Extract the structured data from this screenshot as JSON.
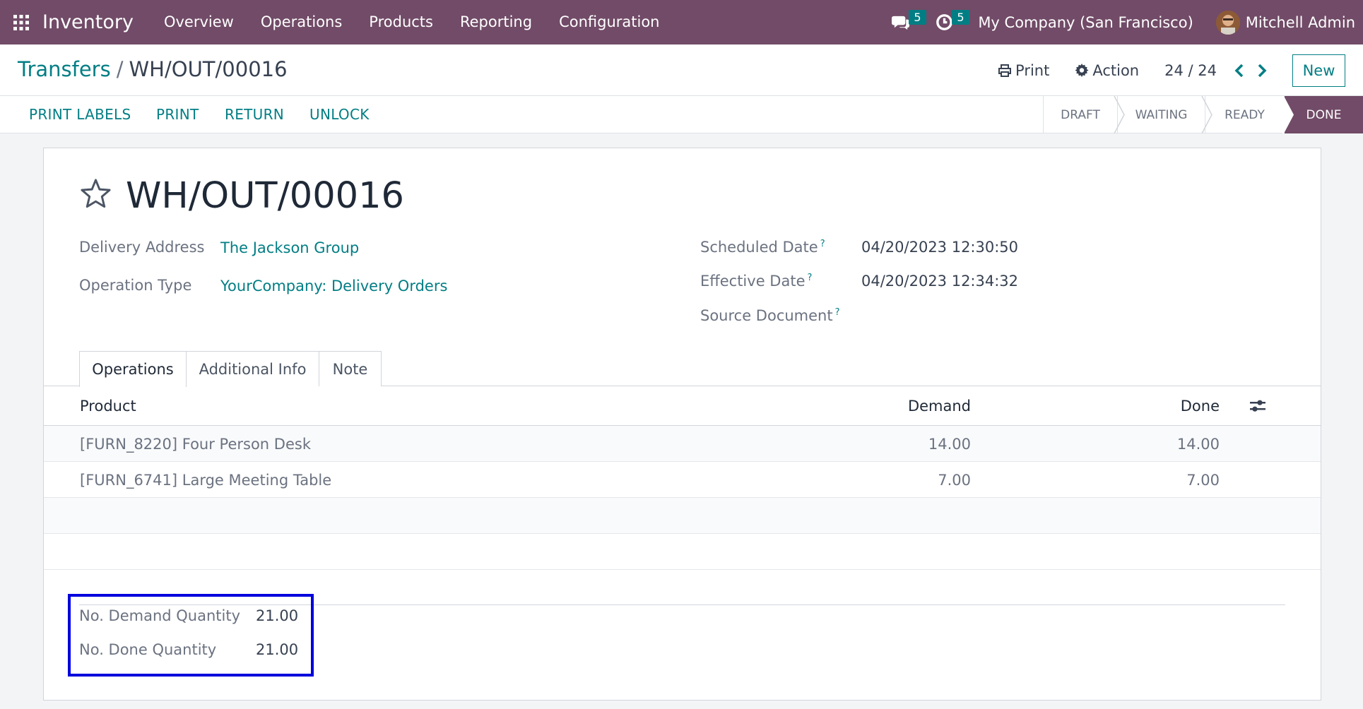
{
  "navbar": {
    "app_name": "Inventory",
    "menu": [
      "Overview",
      "Operations",
      "Products",
      "Reporting",
      "Configuration"
    ],
    "messages_count": "5",
    "activities_count": "5",
    "company": "My Company (San Francisco)",
    "user": "Mitchell Admin",
    "color": "#714b67"
  },
  "control": {
    "breadcrumb_parent": "Transfers",
    "breadcrumb_separator": "/",
    "breadcrumb_current": "WH/OUT/00016",
    "print_label": "Print",
    "action_label": "Action",
    "pager": "24 / 24",
    "new_label": "New"
  },
  "statusbar": {
    "actions": [
      "PRINT LABELS",
      "PRINT",
      "RETURN",
      "UNLOCK"
    ],
    "stages": [
      "DRAFT",
      "WAITING",
      "READY",
      "DONE"
    ],
    "current_stage": "DONE"
  },
  "form": {
    "title": "WH/OUT/00016",
    "delivery_address_label": "Delivery Address",
    "delivery_address": "The Jackson Group",
    "operation_type_label": "Operation Type",
    "operation_type": "YourCompany: Delivery Orders",
    "scheduled_date_label": "Scheduled Date",
    "scheduled_date": "04/20/2023 12:30:50",
    "effective_date_label": "Effective Date",
    "effective_date": "04/20/2023 12:34:32",
    "source_document_label": "Source Document",
    "help_mark": "?"
  },
  "tabs": [
    "Operations",
    "Additional Info",
    "Note"
  ],
  "table": {
    "columns": [
      "Product",
      "Demand",
      "Done"
    ],
    "rows": [
      {
        "product": "[FURN_8220] Four Person Desk",
        "demand": "14.00",
        "done": "14.00"
      },
      {
        "product": "[FURN_6741] Large Meeting Table",
        "demand": "7.00",
        "done": "7.00"
      }
    ]
  },
  "summary": {
    "demand_label": "No. Demand Quantity",
    "demand_value": "21.00",
    "done_label": "No. Done Quantity",
    "done_value": "21.00"
  },
  "colors": {
    "brand": "#714b67",
    "link": "#017e84",
    "highlight": "#0000dd"
  }
}
